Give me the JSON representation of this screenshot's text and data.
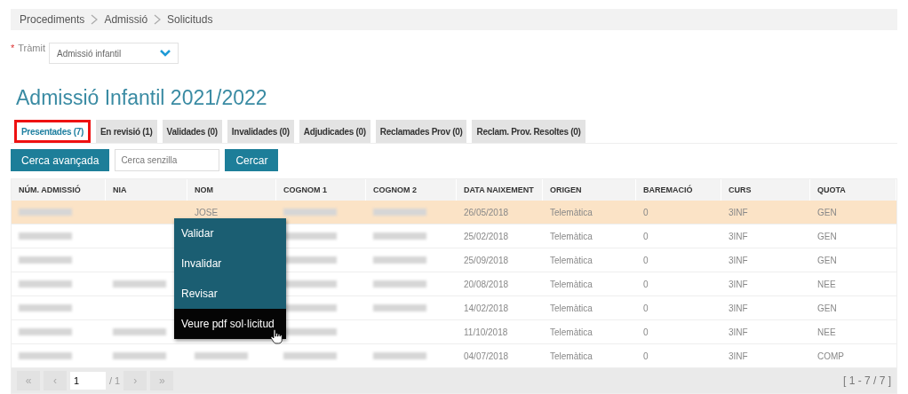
{
  "breadcrumb": [
    "Procediments",
    "Admissió",
    "Solicituds"
  ],
  "tramit": {
    "required_mark": "*",
    "label": "Tràmit",
    "value": "Admissió infantil"
  },
  "title": "Admissió Infantil 2021/2022",
  "tabs": [
    {
      "label": "Presentades (7)",
      "selected": true,
      "highlighted": true
    },
    {
      "label": "En revisió (1)",
      "selected": false,
      "highlighted": false
    },
    {
      "label": "Validades (0)",
      "selected": false,
      "highlighted": false
    },
    {
      "label": "Invalidades (0)",
      "selected": false,
      "highlighted": false
    },
    {
      "label": "Adjudicades (0)",
      "selected": false,
      "highlighted": false
    },
    {
      "label": "Reclamades Prov (0)",
      "selected": false,
      "highlighted": false
    },
    {
      "label": "Reclam. Prov. Resoltes (0)",
      "selected": false,
      "highlighted": false
    }
  ],
  "search": {
    "advanced_button": "Cerca avançada",
    "placeholder": "Cerca senzilla",
    "search_button": "Cercar"
  },
  "table": {
    "columns": [
      "NÚM. ADMISSIÓ",
      "NIA",
      "NOM",
      "COGNOM 1",
      "COGNOM 2",
      "DATA NAIXEMENT",
      "ORIGEN",
      "BAREMACIÓ",
      "CURS",
      "QUOTA"
    ],
    "rows": [
      {
        "selected": true,
        "cells": [
          {
            "kind": "blurred"
          },
          {
            "kind": "blank"
          },
          {
            "kind": "text",
            "text": "JOSE"
          },
          {
            "kind": "blurred"
          },
          {
            "kind": "blurred"
          },
          {
            "kind": "text",
            "text": "26/05/2018"
          },
          {
            "kind": "text",
            "text": "Telemàtica"
          },
          {
            "kind": "text",
            "text": "0"
          },
          {
            "kind": "text",
            "text": "3INF"
          },
          {
            "kind": "text",
            "text": "GEN"
          }
        ]
      },
      {
        "selected": false,
        "cells": [
          {
            "kind": "blurred"
          },
          {
            "kind": "blank"
          },
          {
            "kind": "covered"
          },
          {
            "kind": "blurred"
          },
          {
            "kind": "blurred"
          },
          {
            "kind": "text",
            "text": "25/02/2018"
          },
          {
            "kind": "text",
            "text": "Telemàtica"
          },
          {
            "kind": "text",
            "text": "0"
          },
          {
            "kind": "text",
            "text": "3INF"
          },
          {
            "kind": "text",
            "text": "GEN"
          }
        ]
      },
      {
        "selected": false,
        "cells": [
          {
            "kind": "blurred"
          },
          {
            "kind": "blank"
          },
          {
            "kind": "covered"
          },
          {
            "kind": "blurred"
          },
          {
            "kind": "blurred"
          },
          {
            "kind": "text",
            "text": "25/09/2018"
          },
          {
            "kind": "text",
            "text": "Telemàtica"
          },
          {
            "kind": "text",
            "text": "0"
          },
          {
            "kind": "text",
            "text": "3INF"
          },
          {
            "kind": "text",
            "text": "GEN"
          }
        ]
      },
      {
        "selected": false,
        "cells": [
          {
            "kind": "blurred"
          },
          {
            "kind": "blurred"
          },
          {
            "kind": "covered"
          },
          {
            "kind": "blurred"
          },
          {
            "kind": "blurred"
          },
          {
            "kind": "text",
            "text": "20/08/2018"
          },
          {
            "kind": "text",
            "text": "Telemàtica"
          },
          {
            "kind": "text",
            "text": "0"
          },
          {
            "kind": "text",
            "text": "3INF"
          },
          {
            "kind": "text",
            "text": "NEE"
          }
        ]
      },
      {
        "selected": false,
        "cells": [
          {
            "kind": "blurred"
          },
          {
            "kind": "blank"
          },
          {
            "kind": "covered"
          },
          {
            "kind": "blurred"
          },
          {
            "kind": "blurred"
          },
          {
            "kind": "text",
            "text": "14/02/2018"
          },
          {
            "kind": "text",
            "text": "Telemàtica"
          },
          {
            "kind": "text",
            "text": "0"
          },
          {
            "kind": "text",
            "text": "3INF"
          },
          {
            "kind": "text",
            "text": "GEN"
          }
        ]
      },
      {
        "selected": false,
        "cells": [
          {
            "kind": "blurred"
          },
          {
            "kind": "blurred"
          },
          {
            "kind": "blank"
          },
          {
            "kind": "blurred"
          },
          {
            "kind": "blank"
          },
          {
            "kind": "text",
            "text": "11/10/2018"
          },
          {
            "kind": "text",
            "text": "Telemàtica"
          },
          {
            "kind": "text",
            "text": "0"
          },
          {
            "kind": "text",
            "text": "3INF"
          },
          {
            "kind": "text",
            "text": "NEE"
          }
        ]
      },
      {
        "selected": false,
        "cells": [
          {
            "kind": "blurred"
          },
          {
            "kind": "blurred"
          },
          {
            "kind": "blurred"
          },
          {
            "kind": "blurred"
          },
          {
            "kind": "blurred"
          },
          {
            "kind": "text",
            "text": "04/07/2018"
          },
          {
            "kind": "text",
            "text": "Telemàtica"
          },
          {
            "kind": "text",
            "text": "0"
          },
          {
            "kind": "text",
            "text": "3INF"
          },
          {
            "kind": "text",
            "text": "COMP"
          }
        ]
      }
    ]
  },
  "context_menu": [
    {
      "label": "Validar",
      "selected": false
    },
    {
      "label": "Invalidar",
      "selected": false
    },
    {
      "label": "Revisar",
      "selected": false
    },
    {
      "label": "Veure pdf sol·licitud",
      "selected": true
    }
  ],
  "pager": {
    "first": "«",
    "previous": "‹",
    "page": "1",
    "total": "/ 1",
    "next": "›",
    "last": "»",
    "range": "[ 1 - 7 / 7 ]"
  }
}
